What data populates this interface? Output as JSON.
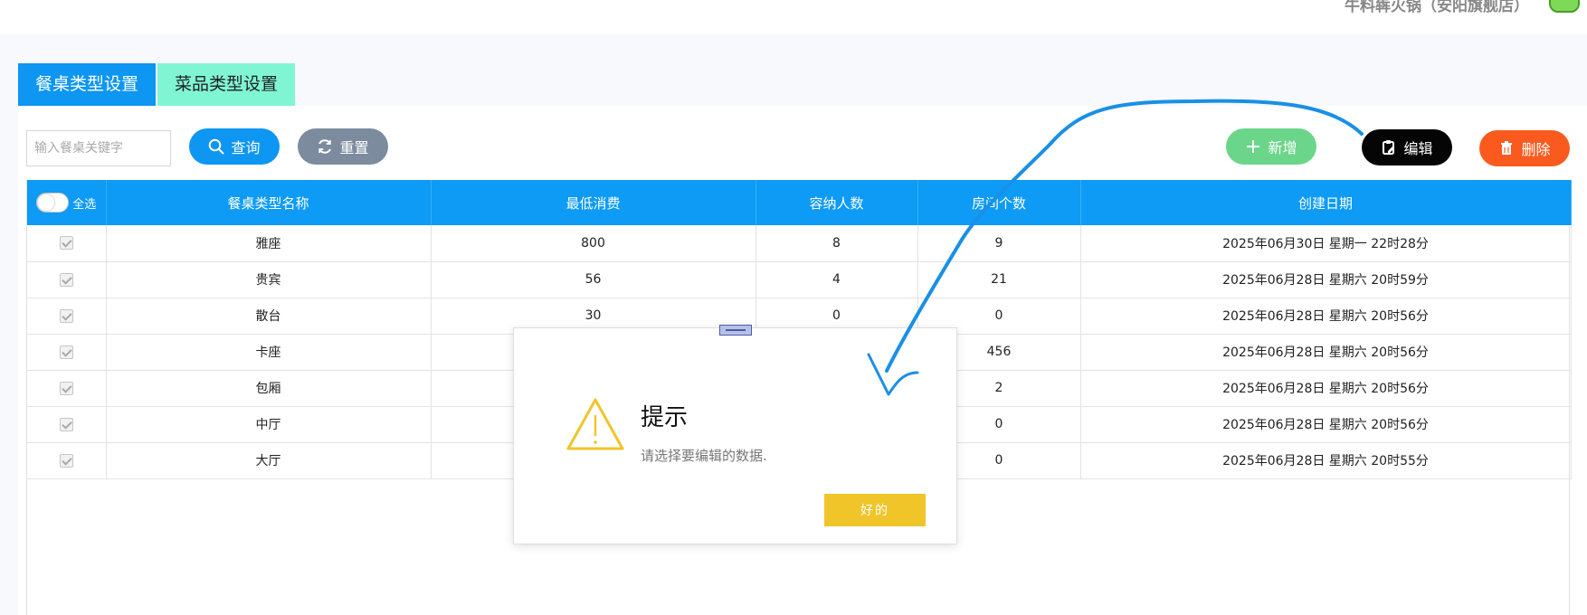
{
  "header": {
    "shop_name": "牛料犇火锅（安阳旗舰店）"
  },
  "tabs": [
    {
      "label": "餐桌类型设置",
      "active": true
    },
    {
      "label": "菜品类型设置",
      "active": false
    }
  ],
  "toolbar": {
    "search_placeholder": "输入餐桌关键字",
    "query_label": "查询",
    "reset_label": "重置",
    "add_label": "新增",
    "edit_label": "编辑",
    "delete_label": "删除"
  },
  "table": {
    "select_all_label": "全选",
    "columns": [
      "餐桌类型名称",
      "最低消费",
      "容纳人数",
      "房间个数",
      "创建日期"
    ],
    "rows": [
      {
        "name": "雅座",
        "min": "800",
        "cap": "8",
        "rooms": "9",
        "date": "2025年06月30日 星期一 22时28分"
      },
      {
        "name": "贵宾",
        "min": "56",
        "cap": "4",
        "rooms": "21",
        "date": "2025年06月28日 星期六 20时59分"
      },
      {
        "name": "散台",
        "min": "30",
        "cap": "0",
        "rooms": "0",
        "date": "2025年06月28日 星期六 20时56分"
      },
      {
        "name": "卡座",
        "min": "",
        "cap": "",
        "rooms": "456",
        "date": "2025年06月28日 星期六 20时56分"
      },
      {
        "name": "包厢",
        "min": "",
        "cap": "",
        "rooms": "2",
        "date": "2025年06月28日 星期六 20时56分"
      },
      {
        "name": "中厅",
        "min": "",
        "cap": "",
        "rooms": "0",
        "date": "2025年06月28日 星期六 20时56分"
      },
      {
        "name": "大厅",
        "min": "",
        "cap": "",
        "rooms": "0",
        "date": "2025年06月28日 星期六 20时55分"
      }
    ]
  },
  "dialog": {
    "title": "提示",
    "message": "请选择要编辑的数据.",
    "ok_label": "好的"
  },
  "colors": {
    "primary": "#0d96f2",
    "tab_alt": "#7ff5d4",
    "add": "#6bd68a",
    "edit": "#050505",
    "delete": "#fa5a1e",
    "warning": "#f0c52a",
    "annotation": "#1a8fe6"
  }
}
